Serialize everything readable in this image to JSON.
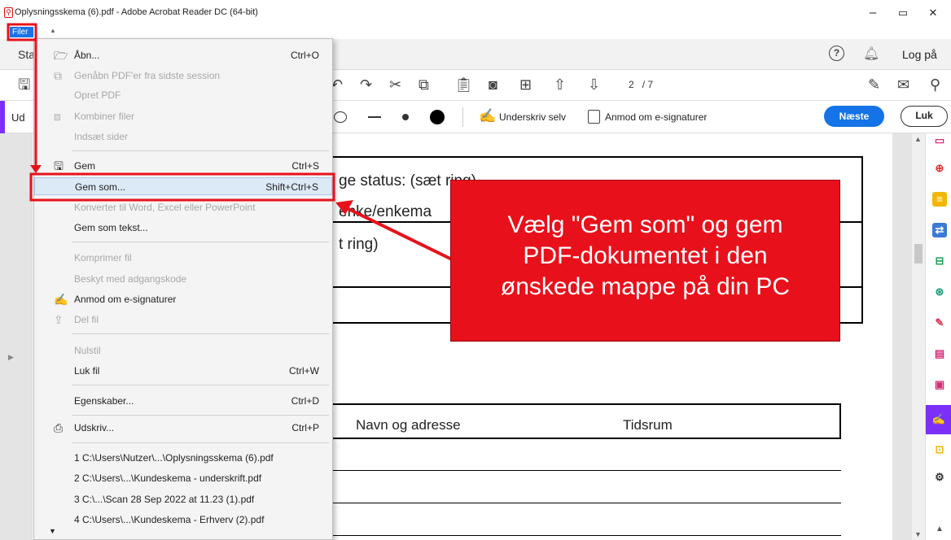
{
  "window": {
    "title": "Oplysningsskema (6).pdf - Adobe Acrobat Reader DC (64-bit)",
    "minimize": "–",
    "restore": "▭",
    "close": "✕"
  },
  "menubar": {
    "filer": "Filer"
  },
  "tabbar": {
    "left_text": "Sta",
    "help": "?",
    "logon": "Log på"
  },
  "toolbar": {
    "page_current": "2",
    "page_total": "/ 7"
  },
  "signbar": {
    "left_text": "Ud",
    "sign_self": "Underskriv selv",
    "request_esign": "Anmod om e-signaturer",
    "next": "Næste",
    "close": "Luk"
  },
  "document": {
    "status_label_bold": "ge status:",
    "status_label_rest": "(sæt ring)",
    "widow_text": "enke/enkema",
    "ring_text": "t ring)",
    "col_name": "Navn og adresse",
    "col_period": "Tidsrum"
  },
  "menu": {
    "items": [
      {
        "label": "Åbn...",
        "shortcut": "Ctrl+O",
        "disabled": false,
        "icon": "folder-icon"
      },
      {
        "label": "Genåbn PDF'er fra sidste session",
        "shortcut": "",
        "disabled": true,
        "icon": "reopen-icon"
      },
      {
        "label": "Opret PDF",
        "shortcut": "",
        "disabled": true,
        "icon": ""
      },
      {
        "label": "Kombiner filer",
        "shortcut": "",
        "disabled": true,
        "icon": "combine-icon"
      },
      {
        "label": "Indsæt sider",
        "shortcut": "",
        "disabled": true,
        "icon": ""
      },
      {
        "label": "Gem",
        "shortcut": "Ctrl+S",
        "disabled": false,
        "icon": "save-icon"
      },
      {
        "label": "Gem som...",
        "shortcut": "Shift+Ctrl+S",
        "disabled": false,
        "icon": ""
      },
      {
        "label": "Konverter til Word, Excel eller PowerPoint",
        "shortcut": "",
        "disabled": true,
        "icon": ""
      },
      {
        "label": "Gem som tekst...",
        "shortcut": "",
        "disabled": false,
        "icon": ""
      },
      {
        "label": "Komprimer fil",
        "shortcut": "",
        "disabled": true,
        "icon": ""
      },
      {
        "label": "Beskyt med adgangskode",
        "shortcut": "",
        "disabled": true,
        "icon": ""
      },
      {
        "label": "Anmod om e-signaturer",
        "shortcut": "",
        "disabled": false,
        "icon": "signature-pen-icon"
      },
      {
        "label": "Del fil",
        "shortcut": "",
        "disabled": true,
        "icon": "share-icon"
      },
      {
        "label": "Nulstil",
        "shortcut": "",
        "disabled": true,
        "icon": ""
      },
      {
        "label": "Luk fil",
        "shortcut": "Ctrl+W",
        "disabled": false,
        "icon": ""
      },
      {
        "label": "Egenskaber...",
        "shortcut": "Ctrl+D",
        "disabled": false,
        "icon": ""
      },
      {
        "label": "Udskriv...",
        "shortcut": "Ctrl+P",
        "disabled": false,
        "icon": "printer-icon"
      },
      {
        "label": "1 C:\\Users\\Nutzer\\...\\Oplysningsskema (6).pdf",
        "shortcut": "",
        "disabled": false,
        "icon": ""
      },
      {
        "label": "2 C:\\Users\\...\\Kundeskema - underskrift.pdf",
        "shortcut": "",
        "disabled": false,
        "icon": ""
      },
      {
        "label": "3 C:\\...\\Scan 28 Sep 2022 at 11.23 (1).pdf",
        "shortcut": "",
        "disabled": false,
        "icon": ""
      },
      {
        "label": "4 C:\\Users\\...\\Kundeskema - Erhverv (2).pdf",
        "shortcut": "",
        "disabled": false,
        "icon": ""
      }
    ]
  },
  "callout": {
    "line1": "Vælg \"Gem som\" og gem",
    "line2": "PDF-dokumentet i den",
    "line3": "ønskede mappe på din PC"
  },
  "colors": {
    "annotation_red": "#e8111b",
    "accent_blue": "#1473e6",
    "sign_purple": "#7b2ff7"
  }
}
